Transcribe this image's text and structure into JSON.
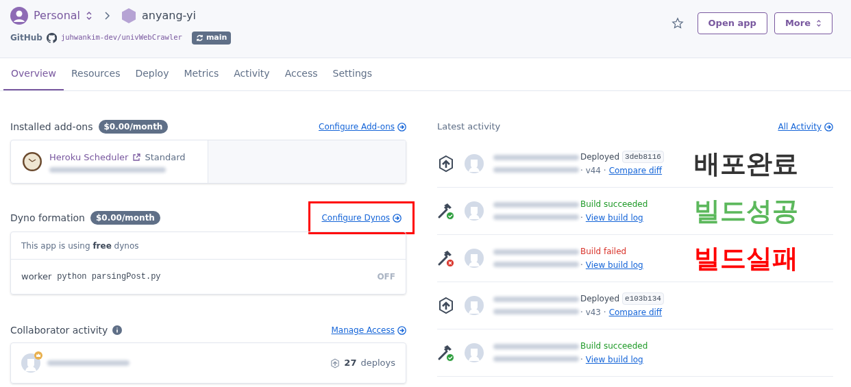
{
  "header": {
    "account": "Personal",
    "app": "anyang-yi",
    "source_label": "GitHub",
    "repo": "juhwankim-dev/univWebCrawler",
    "branch": "main",
    "buttons": [
      "Open app",
      "More"
    ]
  },
  "tabs": [
    {
      "label": "Overview",
      "selected": true
    },
    {
      "label": "Resources",
      "selected": false
    },
    {
      "label": "Deploy",
      "selected": false
    },
    {
      "label": "Metrics",
      "selected": false
    },
    {
      "label": "Activity",
      "selected": false
    },
    {
      "label": "Access",
      "selected": false
    },
    {
      "label": "Settings",
      "selected": false
    }
  ],
  "addons": {
    "title": "Installed add-ons",
    "price": "$0.00/month",
    "link": "Configure Add-ons",
    "items": [
      {
        "name": "Heroku Scheduler",
        "plan": "Standard"
      }
    ]
  },
  "dynos": {
    "title": "Dyno formation",
    "price": "$0.00/month",
    "link": "Configure Dynos",
    "highlighted": true,
    "note": "This app is using **free** dynos",
    "items": [
      {
        "type": "worker",
        "command": "python parsingPost.py",
        "state": "OFF",
        "on": false
      }
    ]
  },
  "collaborators": {
    "title": "Collaborator activity",
    "link": "Manage Access",
    "items": [
      {
        "owner": true,
        "count": "27",
        "unit": "deploys"
      }
    ]
  },
  "activity": {
    "title": "Latest activity",
    "link": "All Activity",
    "items": [
      {
        "kind": "deploy",
        "status": "Deployed",
        "failed": false,
        "hash": "3deb8116",
        "meta": "· v44 ·",
        "link": "Compare diff",
        "note": "배포완료",
        "color": "#333333"
      },
      {
        "kind": "build",
        "status": "Build succeeded",
        "failed": false,
        "meta": "·",
        "link": "View build log",
        "note": "빌드성공",
        "color": "#5cb85c"
      },
      {
        "kind": "build",
        "status": "Build failed",
        "failed": true,
        "meta": "·",
        "link": "View build log",
        "note": "빌드실패",
        "color": "#ff0000"
      },
      {
        "kind": "deploy",
        "status": "Deployed",
        "failed": false,
        "hash": "e103b134",
        "meta": "· v43 ·",
        "link": "Compare diff"
      },
      {
        "kind": "build",
        "status": "Build succeeded",
        "failed": false,
        "meta": "·",
        "link": "View build log"
      }
    ]
  }
}
